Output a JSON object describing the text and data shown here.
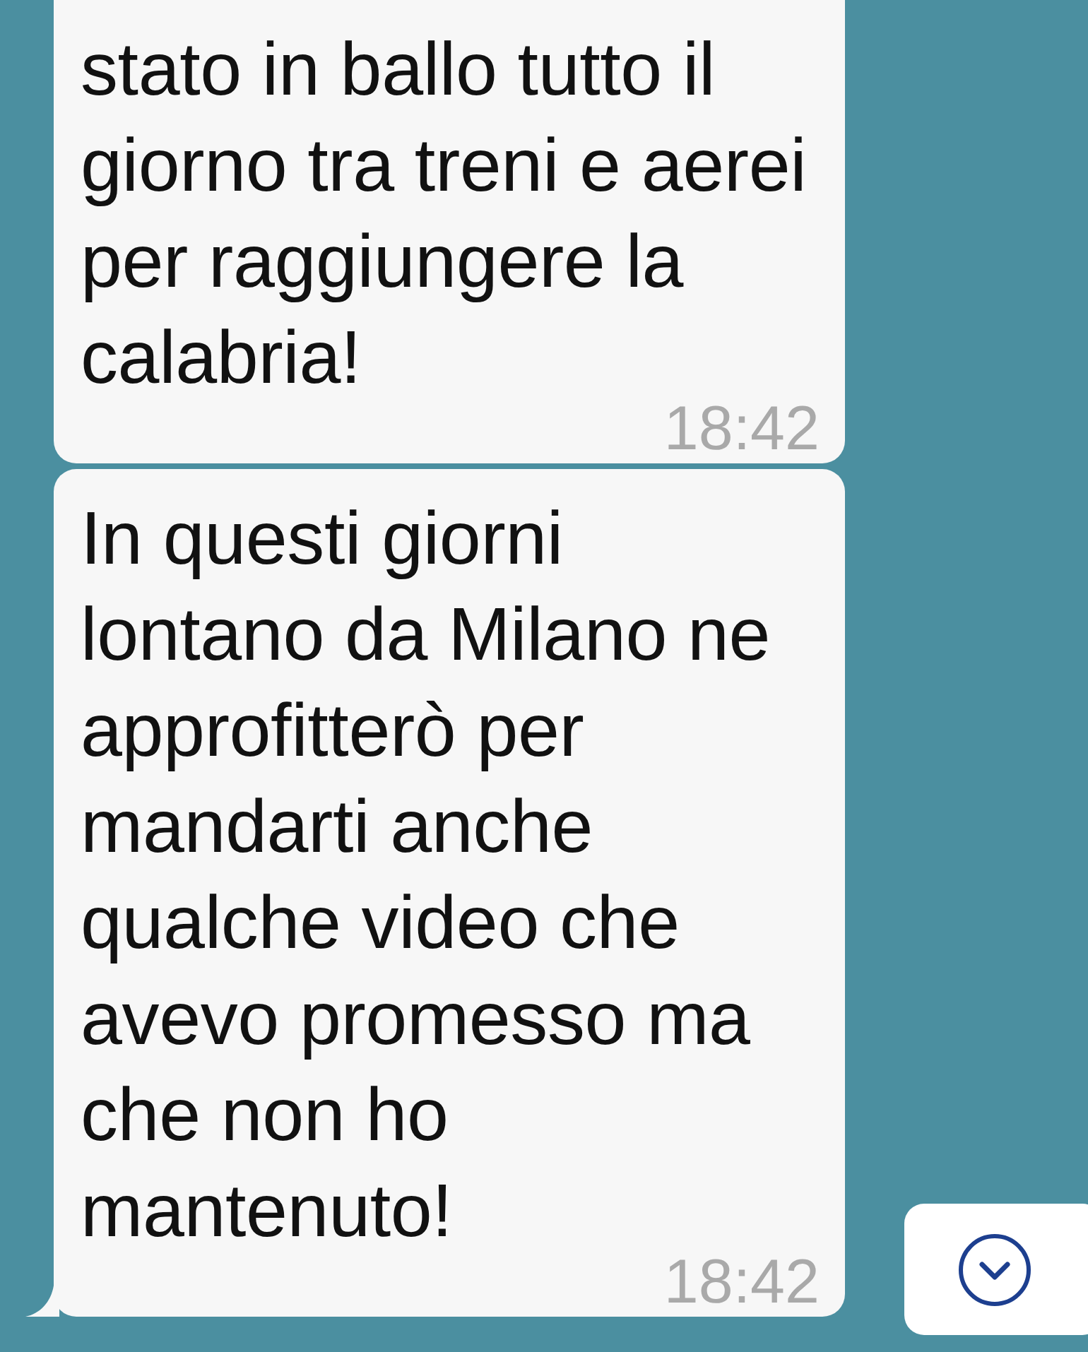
{
  "messages": [
    {
      "text": "stato in ballo tutto il giorno tra treni e aerei per raggiungere la calabria!",
      "time": "18:42",
      "tail": false
    },
    {
      "text": "In questi giorni lontano da Milano ne approfitterò per mandarti anche qualche video che avevo promesso ma che non ho mantenuto!",
      "time": "18:42",
      "tail": true
    }
  ]
}
